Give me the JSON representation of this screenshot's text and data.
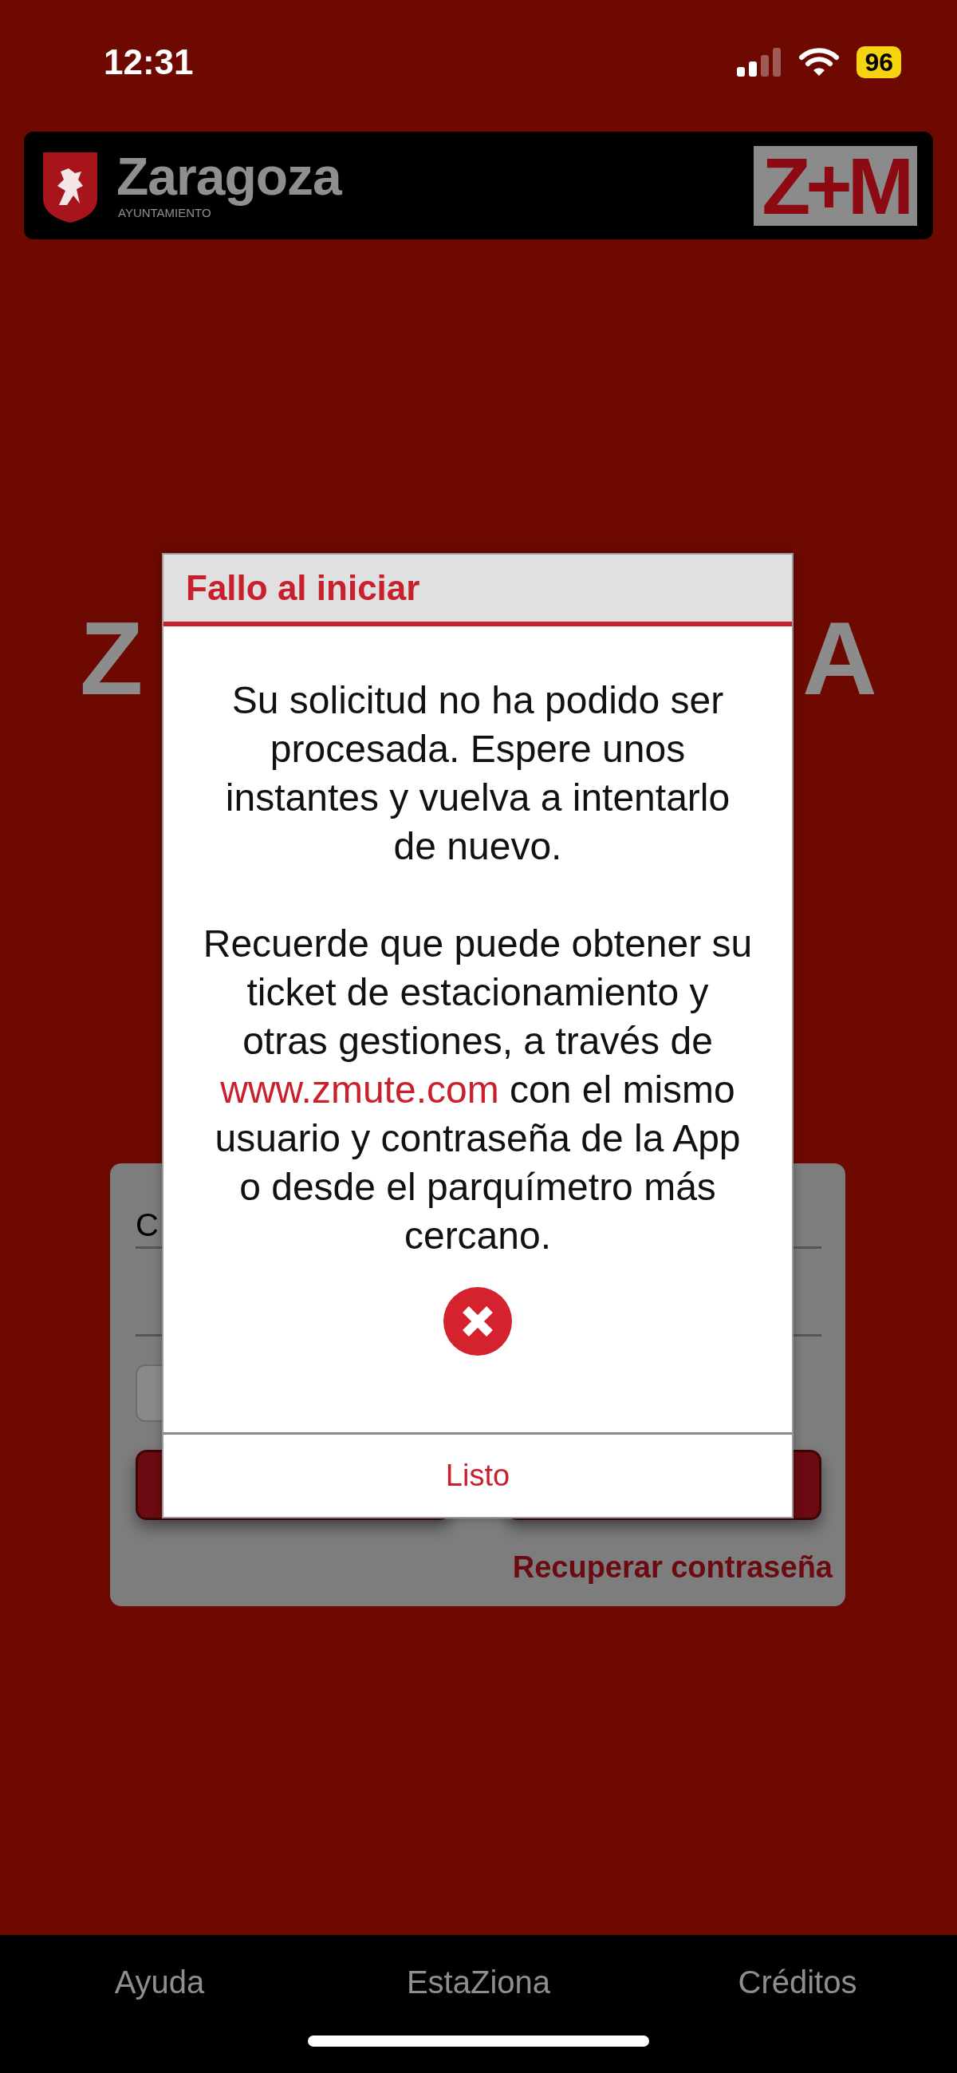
{
  "status_bar": {
    "time": "12:31",
    "battery": "96"
  },
  "header": {
    "city": "Zaragoza",
    "subtitle": "AYUNTAMIENTO",
    "logo": "Z+M"
  },
  "background_logo": {
    "left_fragment": "Z",
    "right_fragment": "A"
  },
  "login_card": {
    "field_fragment": "C",
    "link": "Recuperar contraseña"
  },
  "dialog": {
    "title": "Fallo al iniciar",
    "message": "Su solicitud no ha podido ser procesada. Espere unos instantes y vuelva a intentarlo de nuevo.",
    "note": {
      "before": "Recuerde que puede obtener su ticket de estacionamiento y otras gestiones, a través de",
      "link": "www.zmute.com",
      "after": "con el mismo usuario y contraseña de la App o desde el parquímetro más cercano."
    },
    "button": "Listo"
  },
  "tab_bar": {
    "items": [
      {
        "label": "Ayuda"
      },
      {
        "label": "EstaZiona"
      },
      {
        "label": "Créditos"
      }
    ]
  }
}
